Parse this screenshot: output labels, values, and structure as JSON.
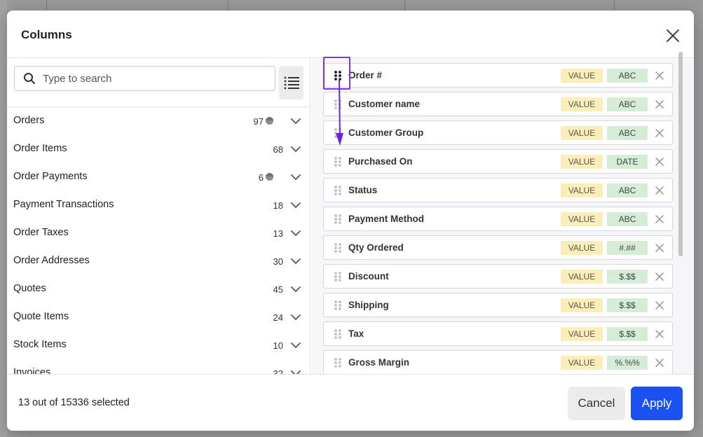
{
  "modal": {
    "title": "Columns",
    "close_icon": "close-icon"
  },
  "search": {
    "placeholder": "Type to search",
    "value": ""
  },
  "groups": [
    {
      "name": "Orders",
      "count": "97",
      "has_dot": true
    },
    {
      "name": "Order Items",
      "count": "68",
      "has_dot": false
    },
    {
      "name": "Order Payments",
      "count": "6",
      "has_dot": true
    },
    {
      "name": "Payment Transactions",
      "count": "18",
      "has_dot": false
    },
    {
      "name": "Order Taxes",
      "count": "13",
      "has_dot": false
    },
    {
      "name": "Order Addresses",
      "count": "30",
      "has_dot": false
    },
    {
      "name": "Quotes",
      "count": "45",
      "has_dot": false
    },
    {
      "name": "Quote Items",
      "count": "24",
      "has_dot": false
    },
    {
      "name": "Stock Items",
      "count": "10",
      "has_dot": false
    },
    {
      "name": "Invoices",
      "count": "32",
      "has_dot": false
    }
  ],
  "columns": [
    {
      "name": "Order #",
      "value_tag": "VALUE",
      "type_tag": "ABC"
    },
    {
      "name": "Customer name",
      "value_tag": "VALUE",
      "type_tag": "ABC"
    },
    {
      "name": "Customer Group",
      "value_tag": "VALUE",
      "type_tag": "ABC"
    },
    {
      "name": "Purchased On",
      "value_tag": "VALUE",
      "type_tag": "DATE"
    },
    {
      "name": "Status",
      "value_tag": "VALUE",
      "type_tag": "ABC"
    },
    {
      "name": "Payment Method",
      "value_tag": "VALUE",
      "type_tag": "ABC"
    },
    {
      "name": "Qty Ordered",
      "value_tag": "VALUE",
      "type_tag": "#.##"
    },
    {
      "name": "Discount",
      "value_tag": "VALUE",
      "type_tag": "$.$$"
    },
    {
      "name": "Shipping",
      "value_tag": "VALUE",
      "type_tag": "$.$$"
    },
    {
      "name": "Tax",
      "value_tag": "VALUE",
      "type_tag": "$.$$"
    },
    {
      "name": "Gross Margin",
      "value_tag": "VALUE",
      "type_tag": "%.%%"
    }
  ],
  "footer": {
    "selected_text": "13 out of 15336 selected",
    "cancel_label": "Cancel",
    "apply_label": "Apply"
  },
  "colors": {
    "accent": "#1a51f0",
    "highlight": "#7b2ff2",
    "value_tag_bg": "#fbeeb8",
    "type_tag_bg": "#d5ecd7"
  }
}
